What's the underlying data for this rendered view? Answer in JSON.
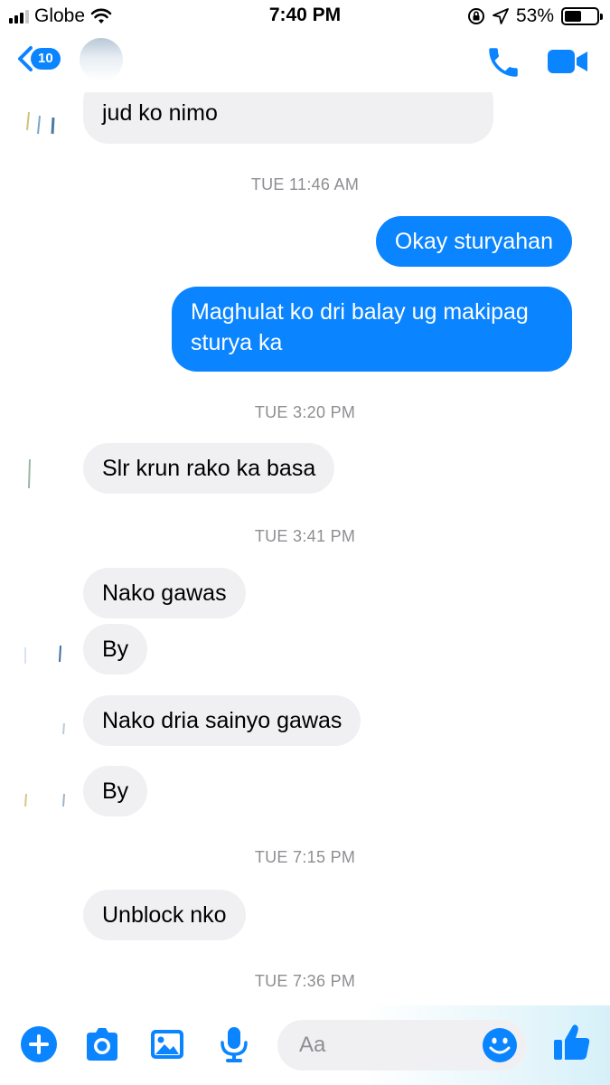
{
  "status_bar": {
    "carrier": "Globe",
    "time": "7:40 PM",
    "battery_percent": "53%",
    "battery_level": 0.53
  },
  "nav": {
    "back_badge": "10",
    "accent_color": "#0b84ff"
  },
  "thread": {
    "partial_message": "jud ko nimo",
    "timestamps": [
      "TUE 11:46 AM",
      "TUE 3:20 PM",
      "TUE 3:41 PM",
      "TUE 7:15 PM",
      "TUE 7:36 PM"
    ],
    "sent": [
      "Okay sturyahan",
      "Maghulat ko dri balay ug makipag",
      "sturya ka"
    ],
    "received": [
      "Slr krun rako ka basa",
      "Nako gawas",
      "By",
      "Nako dria sainyo gawas",
      "By",
      "Unblock nko"
    ]
  },
  "composer": {
    "placeholder": "Aa",
    "icons": [
      "plus-icon",
      "camera-icon",
      "photo-icon",
      "microphone-icon",
      "emoji-icon",
      "thumbs-up-icon"
    ]
  }
}
